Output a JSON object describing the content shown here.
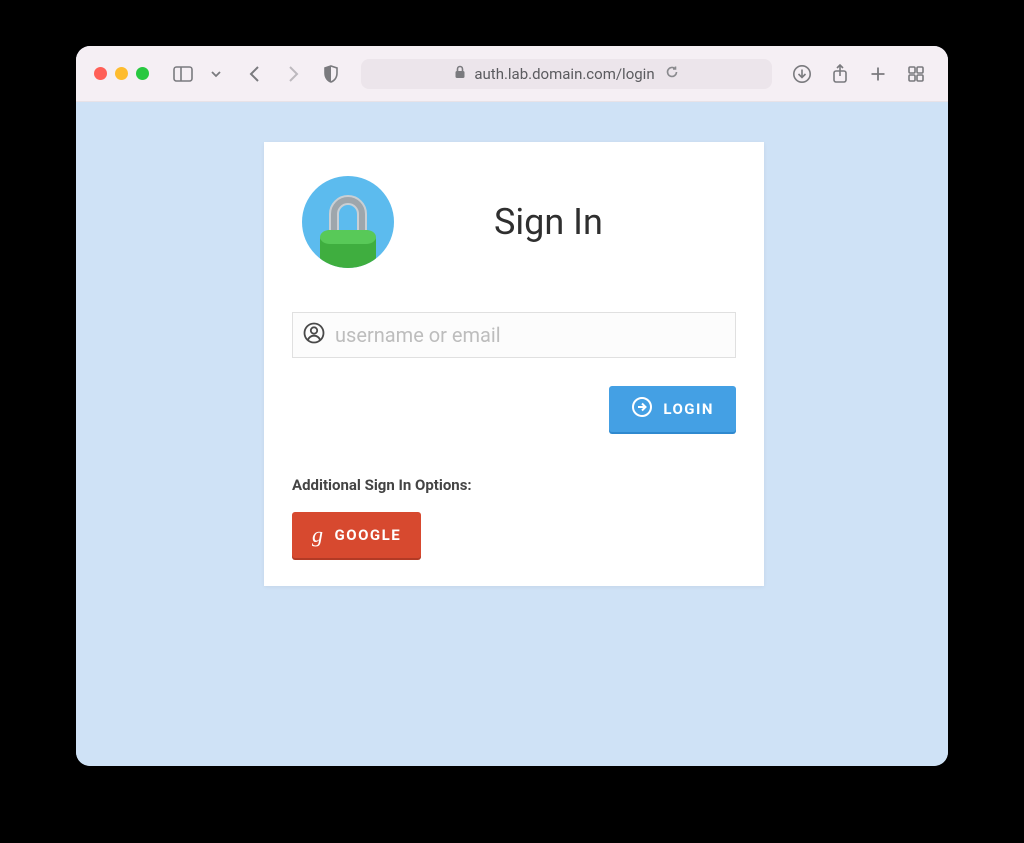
{
  "browser": {
    "url": "auth.lab.domain.com/login"
  },
  "login": {
    "title": "Sign In",
    "username_placeholder": "username or email",
    "login_button": "LOGIN",
    "additional_label": "Additional Sign In Options:",
    "google_button": "GOOGLE"
  }
}
